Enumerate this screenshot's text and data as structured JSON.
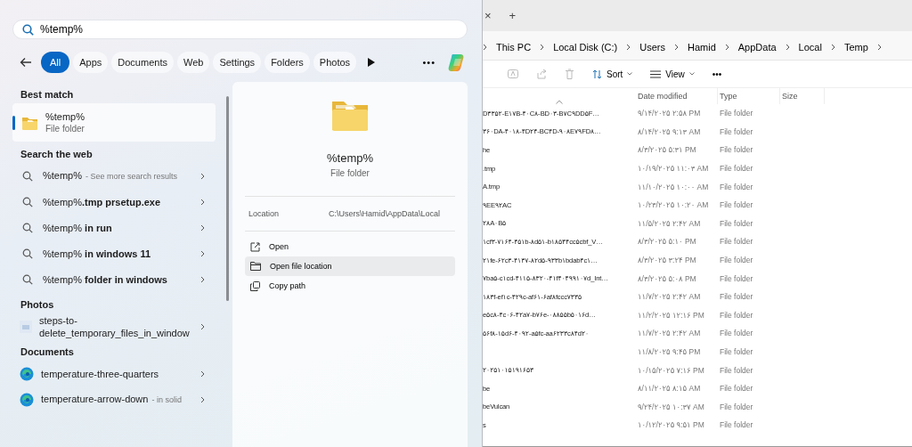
{
  "search": {
    "value": "%temp%"
  },
  "filters": [
    {
      "label": "All",
      "selected": true
    },
    {
      "label": "Apps",
      "selected": false
    },
    {
      "label": "Documents",
      "selected": false
    },
    {
      "label": "Web",
      "selected": false
    },
    {
      "label": "Settings",
      "selected": false
    },
    {
      "label": "Folders",
      "selected": false
    },
    {
      "label": "Photos",
      "selected": false
    }
  ],
  "filter_more": "•••",
  "sections": [
    {
      "title": "Best match",
      "items": [
        {
          "kind": "folder",
          "title": "%temp%",
          "subtitle": "File folder",
          "selected": true
        }
      ]
    },
    {
      "title": "Search the web",
      "items": [
        {
          "kind": "web",
          "title": "%temp%",
          "note": "- See more search results",
          "selected": false
        },
        {
          "kind": "web",
          "title": "%temp%**.tmp prsetup.exe**",
          "selected": false
        },
        {
          "kind": "web",
          "title": "%temp% **in run**",
          "selected": false
        },
        {
          "kind": "web",
          "title": "%temp% **in windows 11**",
          "selected": false
        },
        {
          "kind": "web",
          "title": "%temp% **folder in windows**",
          "selected": false
        }
      ]
    },
    {
      "title": "Photos",
      "items": [
        {
          "kind": "photo",
          "title": "steps-to-delete_temporary_files_in_window",
          "selected": false
        }
      ]
    },
    {
      "title": "Documents",
      "items": [
        {
          "kind": "edge",
          "title": "temperature-three-quarters",
          "selected": false
        },
        {
          "kind": "edge",
          "title": "temperature-arrow-down",
          "note": "- in solid",
          "selected": false
        }
      ]
    }
  ],
  "preview": {
    "title": "%temp%",
    "subtitle": "File folder",
    "location_label": "Location",
    "location": "C:\\Users\\Hamid\\AppData\\Local",
    "actions": [
      {
        "kind": "open",
        "label": "Open",
        "highlighted": false
      },
      {
        "kind": "folder",
        "label": "Open file location",
        "highlighted": true
      },
      {
        "kind": "copy",
        "label": "Copy path",
        "highlighted": false
      }
    ]
  },
  "explorer": {
    "tab_close": "×",
    "new_tab": "+",
    "breadcrumb": [
      "This PC",
      "Local Disk (C:)",
      "Users",
      "Hamid",
      "AppData",
      "Local",
      "Temp"
    ],
    "toolbar": {
      "sort": "Sort",
      "view": "View",
      "more": "•••"
    },
    "columns": [
      "Date modified",
      "Type",
      "Size"
    ],
    "rows": [
      {
        "name": "D۳۳۵۲-E۱۷B-۴۰C۸-BD۰۳-B۷C۹DD۵F…",
        "date": "۹/۱۴/۲۰۲۵ ۲:۵۸ PM",
        "type": "File folder"
      },
      {
        "name": "۳۶۰DA-۴۰۱۸-۴D۲۴-BC۴D-۹۰۸E۷۹FD۸…",
        "date": "۸/۱۴/۲۰۲۵ ۹:۱۳ AM",
        "type": "File folder"
      },
      {
        "name": "he",
        "date": "۸/۳/۲۰۲۵ ۵:۳۱ PM",
        "type": "File folder"
      },
      {
        "name": ".tmp",
        "date": "۱۰/۱۹/۲۰۲۵ ۱۱:۰۳ AM",
        "type": "File folder"
      },
      {
        "name": "A.tmp",
        "date": "۱۱/۱۰/۲۰۲۵ ۱۰:۰۰ AM",
        "type": "File folder"
      },
      {
        "name": "۹EE۹۲AC",
        "date": "۱۰/۲۳/۲۰۲۵ ۱۰:۲۰ AM",
        "type": "File folder"
      },
      {
        "name": "۲۸A۰B۵",
        "date": "۱۱/۵/۲۰۲۵ ۲:۴۲ AM",
        "type": "File folder"
      },
      {
        "name": "۱cf۳-۷۱۶۴-۴۵۱b-۸d۵۱-b۱۸۵۴۴cc۵cbf_V…",
        "date": "۸/۳/۲۰۲۵ ۵:۱۰ PM",
        "type": "File folder"
      },
      {
        "name": "۲۱fe-۶۲c۳-۴۱۳۷-۸۲d۵-۹۳۳b۱bdab۴c۱…",
        "date": "۸/۳/۲۰۲۵ ۳:۲۴ PM",
        "type": "File folder"
      },
      {
        "name": "۷ba۵-c۱cd-۴۱۱۵-۸۳۲۰-۴۱f۴۰۴۹۹۱۰۷d_Int…",
        "date": "۸/۳/۲۰۲۵ ۵:۰۸ PM",
        "type": "File folder"
      },
      {
        "name": "۱۸۳f-ef۱c-۴۲۹c-af۶۱-۶af۸fccc۷۳۳۵",
        "date": "۱۱/۷/۲۰۲۵ ۲:۴۲ AM",
        "type": "File folder"
      },
      {
        "name": "e۵c۸-۴c۰۶-۴۲a۷-b۷۶e-۰۸۸۵۵b۵۰۱۶d…",
        "date": "۱۱/۲/۲۰۲۵ ۱۲:۱۶ PM",
        "type": "File folder"
      },
      {
        "name": "۵۶f۸-۱۵d۶-۴۰۹۲-a۵fc-aa۶۲۳۳c۸۴d۲۰",
        "date": "۱۱/۷/۲۰۲۵ ۲:۴۲ AM",
        "type": "File folder"
      },
      {
        "date": "۱۱/۸/۲۰۲۵ ۹:۴۵ PM",
        "type": "File folder"
      },
      {
        "name": "۲۰۲۵۱۰۱۵۱۹۱۶۵۳",
        "date": "۱۰/۱۵/۲۰۲۵ ۷:۱۶ PM",
        "type": "File folder"
      },
      {
        "name": "be",
        "date": "۸/۱۱/۲۰۲۵ ۸:۱۵ AM",
        "type": "File folder"
      },
      {
        "name": "beVulcan",
        "date": "۹/۲۴/۲۰۲۵ ۱۰:۳۷ AM",
        "type": "File folder"
      },
      {
        "name": "s",
        "date": "۱۰/۱۲/۲۰۲۵ ۹:۵۱ PM",
        "type": "File folder"
      }
    ]
  }
}
